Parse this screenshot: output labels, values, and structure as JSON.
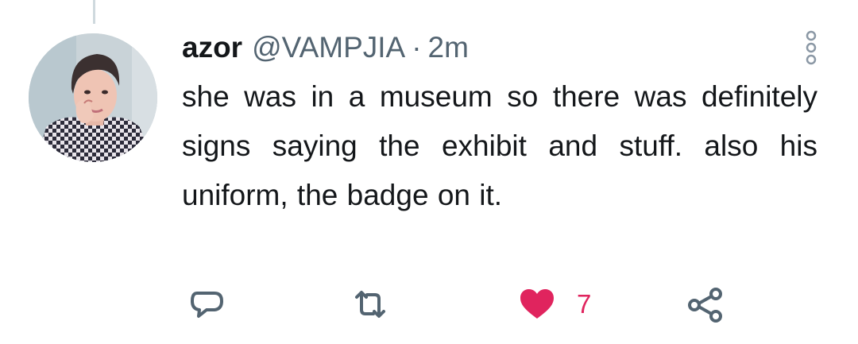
{
  "tweet": {
    "display_name": "azor",
    "handle": "@VAMPJIA",
    "separator": "·",
    "time": "2m",
    "text": "she was in a museum so there was definitely signs saying the exhibit and stuff. also his uniform, the badge on it."
  },
  "actions": {
    "reply_icon": "reply-icon",
    "retweet_icon": "retweet-icon",
    "like_icon": "heart-icon",
    "like_count": "7",
    "share_icon": "share-icon",
    "liked": true
  },
  "colors": {
    "like_accent": "#e0245e",
    "icon_gray": "#536471",
    "text": "#14171a",
    "thread_line": "#cfd9de"
  }
}
